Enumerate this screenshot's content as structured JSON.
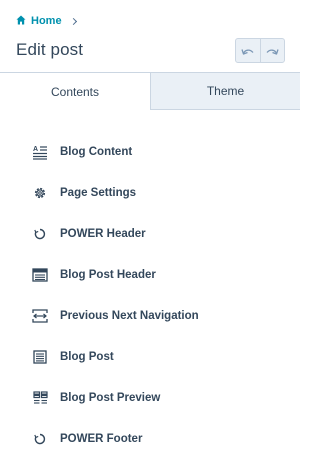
{
  "breadcrumb": {
    "home_label": "Home"
  },
  "header": {
    "title": "Edit post"
  },
  "toolbar": {
    "undo_icon": "undo-icon",
    "redo_icon": "redo-icon"
  },
  "tabs": [
    {
      "label": "Contents",
      "active": true
    },
    {
      "label": "Theme",
      "active": false
    }
  ],
  "modules": [
    {
      "label": "Blog Content",
      "icon": "rich-text-icon"
    },
    {
      "label": "Page Settings",
      "icon": "gear-icon"
    },
    {
      "label": "POWER Header",
      "icon": "spinner-icon"
    },
    {
      "label": "Blog Post Header",
      "icon": "header-module-icon"
    },
    {
      "label": "Previous Next Navigation",
      "icon": "prev-next-icon"
    },
    {
      "label": "Blog Post",
      "icon": "document-icon"
    },
    {
      "label": "Blog Post Preview",
      "icon": "preview-grid-icon"
    },
    {
      "label": "POWER Footer",
      "icon": "spinner-icon"
    }
  ],
  "colors": {
    "link": "#0091ae",
    "text": "#33475b",
    "tab_inactive_bg": "#eaf0f6",
    "border": "#cbd6e2"
  }
}
